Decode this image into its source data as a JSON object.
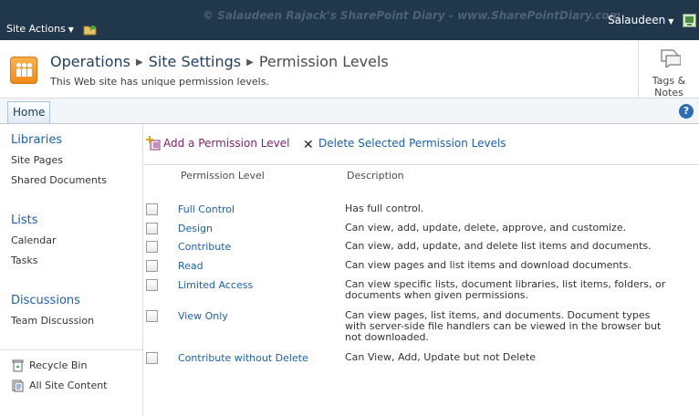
{
  "topbar": {
    "site_actions": "Site Actions",
    "watermark": "© Salaudeen Rajack's SharePoint Diary - www.SharePointDiary.com",
    "user": "Salaudeen"
  },
  "title_area": {
    "crumbs": [
      "Operations",
      "Site Settings",
      "Permission Levels"
    ],
    "message": "This Web site has unique permission levels.",
    "tags_label_1": "Tags &",
    "tags_label_2": "Notes"
  },
  "tabs": {
    "home": "Home",
    "help": "?"
  },
  "quicklaunch": {
    "libraries": "Libraries",
    "site_pages": "Site Pages",
    "shared_documents": "Shared Documents",
    "lists": "Lists",
    "calendar": "Calendar",
    "tasks": "Tasks",
    "discussions": "Discussions",
    "team_discussion": "Team Discussion",
    "recycle_bin": "Recycle Bin",
    "all_site_content": "All Site Content"
  },
  "toolbar": {
    "add": "Add a Permission Level",
    "delete": "Delete Selected Permission Levels"
  },
  "table": {
    "col_level": "Permission Level",
    "col_description": "Description",
    "rows": [
      {
        "name": "Full Control",
        "description": "Has full control."
      },
      {
        "name": "Design",
        "description": "Can view, add, update, delete, approve, and customize."
      },
      {
        "name": "Contribute",
        "description": "Can view, add, update, and delete list items and documents."
      },
      {
        "name": "Read",
        "description": "Can view pages and list items and download documents."
      },
      {
        "name": "Limited Access",
        "description": "Can view specific lists, document libraries, list items, folders, or documents when given permissions."
      },
      {
        "name": "View Only",
        "description": "Can view pages, list items, and documents. Document types with server-side file handlers can be viewed in the browser but not downloaded."
      },
      {
        "name": "Contribute without Delete",
        "description": "Can View, Add, Update but not Delete"
      }
    ]
  },
  "icons": {
    "browse": "folder-arrow-icon",
    "user": "user-presence-icon",
    "logo": "site-logo-icon",
    "tags": "tags-notes-icon",
    "help": "help-icon",
    "add": "add-permission-icon",
    "delete": "delete-x-icon",
    "recycle": "recycle-bin-icon",
    "all_content": "all-site-content-icon"
  },
  "colors": {
    "topbar": "#21374c",
    "link": "#1c5fae",
    "add_link": "#7f1f6d",
    "logo": "#f08a1a"
  }
}
